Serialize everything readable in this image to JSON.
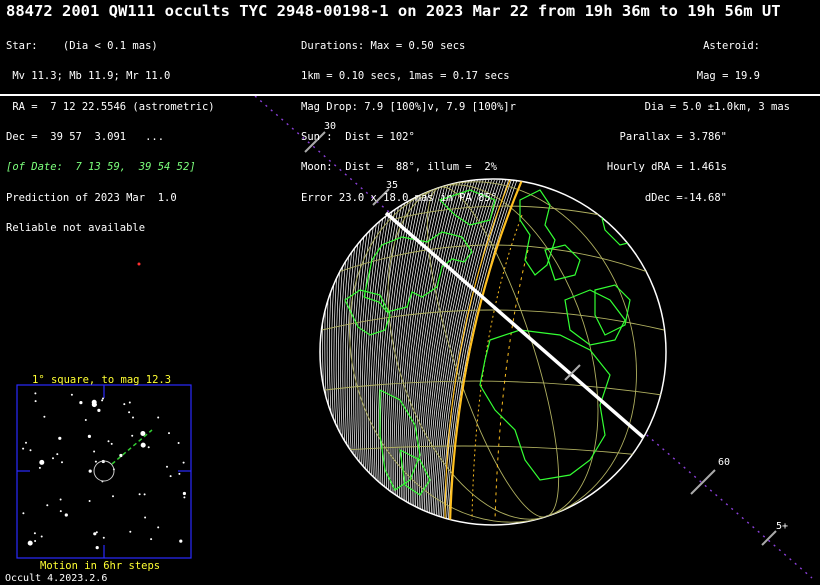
{
  "title": "88472 2001 QW111 occults TYC 2948-00198-1 on 2023 Mar 22 from 19h 36m to 19h 56m UT",
  "star": {
    "lines": [
      "Star:    (Dia < 0.1 mas)",
      " Mv 11.3; Mb 11.9; Mr 11.0",
      " RA =  7 12 22.5546 (astrometric)",
      "Dec =  39 57  3.091   ...",
      "[of Date:  7 13 59,  39 54 52]",
      "Prediction of 2023 Mar  1.0",
      "Reliable not available"
    ]
  },
  "event": {
    "lines": [
      "Durations: Max = 0.50 secs",
      "1km = 0.10 secs, 1mas = 0.17 secs",
      "Mag Drop: 7.9 [100%]v, 7.9 [100%]r",
      "Sun :  Dist = 102°",
      "Moon:  Dist =  88°, illum =  2%",
      "Error 23.0 x 18.0 mas in PA 85°"
    ]
  },
  "asteroid": {
    "lines": [
      "Asteroid:",
      "Mag = 19.9",
      "Dia = 5.0 ±1.0km, 3 mas",
      "Parallax = 3.786\"",
      "Hourly dRA = 1.461s",
      "dDec =-14.68\""
    ]
  },
  "path_labels": [
    "30",
    "35",
    "60",
    "5+"
  ],
  "inset": {
    "title": "1° square, to mag 12.3",
    "footer": "Motion in 6hr steps"
  },
  "version": "Occult 4.2023.2.6",
  "colors": {
    "background": "#000000",
    "text": "#ffffff",
    "coast": "#33ff33",
    "shadow_edge": "#ffc020",
    "path_line": "#ffffff",
    "grid": "#b0b060",
    "inset_frame": "#2a2aff",
    "inset_text": "#ffff33",
    "track": "#8a3fd8"
  }
}
